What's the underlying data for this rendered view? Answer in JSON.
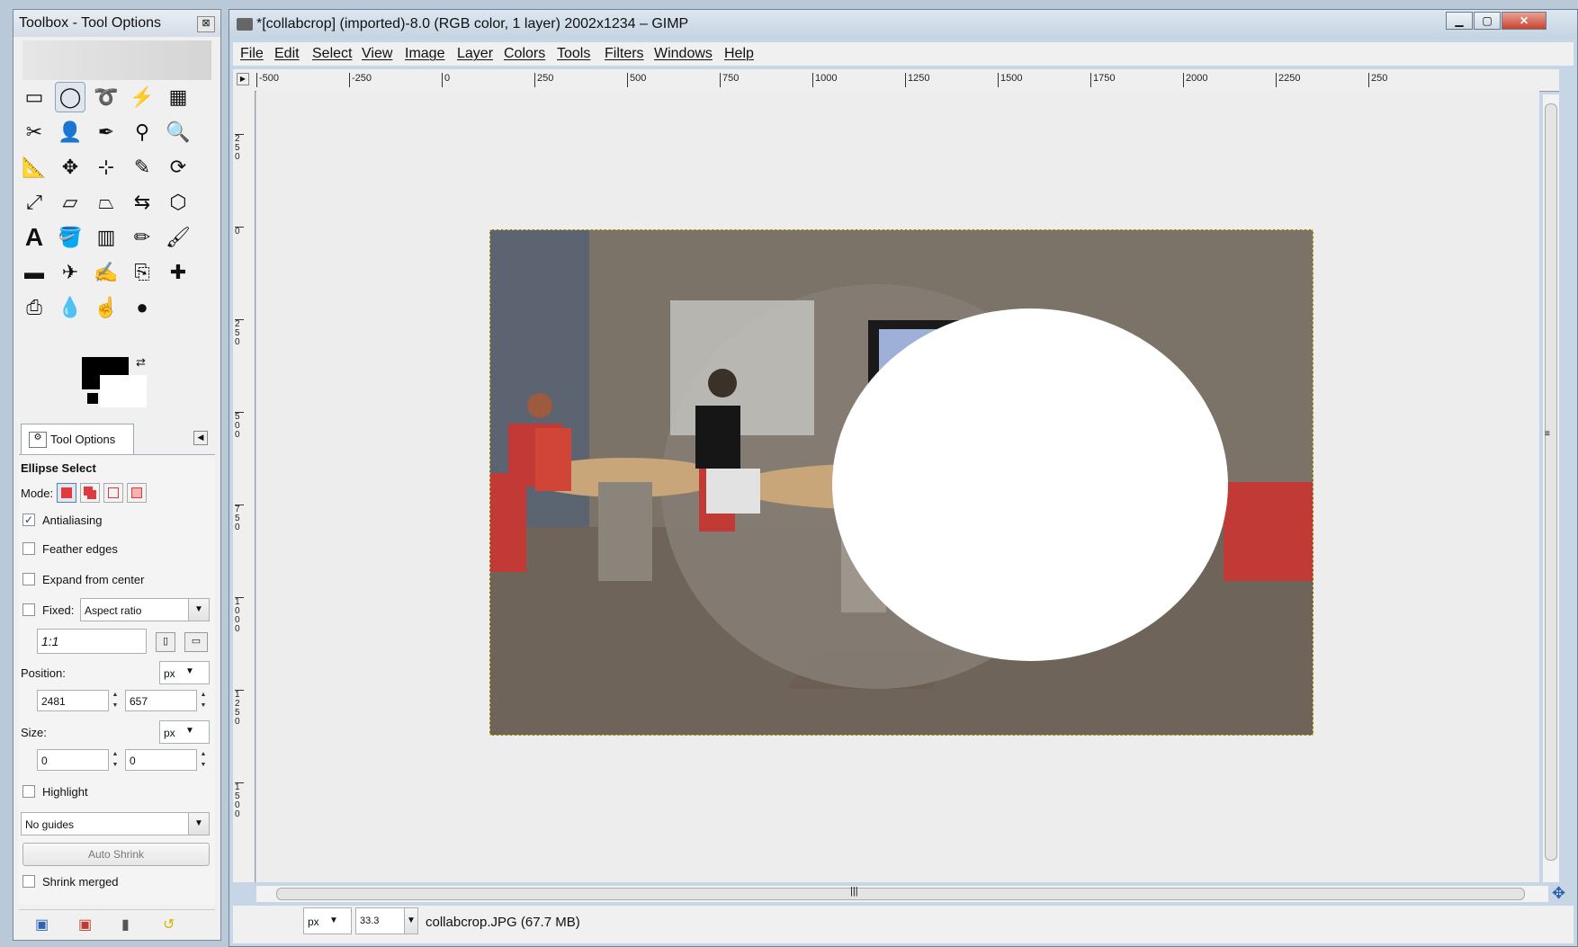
{
  "toolbox": {
    "title": "Toolbox - Tool Options",
    "close_icon": "close-icon",
    "tools": [
      "rect-select-icon",
      "ellipse-select-icon",
      "free-select-icon",
      "fuzzy-select-icon",
      "color-select-icon",
      "scissors-icon",
      "foreground-select-icon",
      "paths-icon",
      "color-picker-icon",
      "zoom-icon",
      "measure-icon",
      "move-icon",
      "align-icon",
      "crop-icon",
      "rotate-icon",
      "scale-icon",
      "shear-icon",
      "perspective-icon",
      "flip-icon",
      "cage-icon",
      "text-icon",
      "bucket-fill-icon",
      "blend-icon",
      "pencil-icon",
      "paintbrush-icon",
      "eraser-icon",
      "airbrush-icon",
      "ink-icon",
      "clone-icon",
      "heal-icon",
      "perspective-clone-icon",
      "blur-icon",
      "smudge-icon",
      "dodge-burn-icon"
    ],
    "tab_label": "Tool Options",
    "tool_name": "Ellipse Select",
    "mode_label": "Mode:",
    "antialiasing": "Antialiasing",
    "feather_edges": "Feather edges",
    "expand_from_center": "Expand from center",
    "fixed_label": "Fixed:",
    "fixed_value": "Aspect ratio",
    "ratio_value": "1:1",
    "position_label": "Position:",
    "position_unit": "px",
    "position_x": "2481",
    "position_y": "657",
    "size_label": "Size:",
    "size_unit": "px",
    "size_w": "0",
    "size_h": "0",
    "highlight": "Highlight",
    "guides_value": "No guides",
    "auto_shrink": "Auto Shrink",
    "shrink_merged": "Shrink merged"
  },
  "main": {
    "title": "*[collabcrop] (imported)-8.0 (RGB color, 1 layer) 2002x1234 – GIMP",
    "menus": [
      "File",
      "Edit",
      "Select",
      "View",
      "Image",
      "Layer",
      "Colors",
      "Tools",
      "Filters",
      "Windows",
      "Help"
    ],
    "ruler_labels": [
      "-500",
      "-250",
      "0",
      "250",
      "500",
      "750",
      "1000",
      "1250",
      "1500",
      "1750",
      "2000",
      "2250",
      "250"
    ],
    "vruler_labels": [
      "250",
      "0",
      "250",
      "500",
      "750",
      "1000",
      "1250",
      "1500"
    ],
    "status_unit": "px",
    "status_zoom": "33.3",
    "status_file": "collabcrop.JPG (67.7 MB)"
  },
  "colors": {
    "accent": "#1a3d8a",
    "foreground": "#000000",
    "background": "#ffffff",
    "selection_border": "#e8d84a"
  }
}
